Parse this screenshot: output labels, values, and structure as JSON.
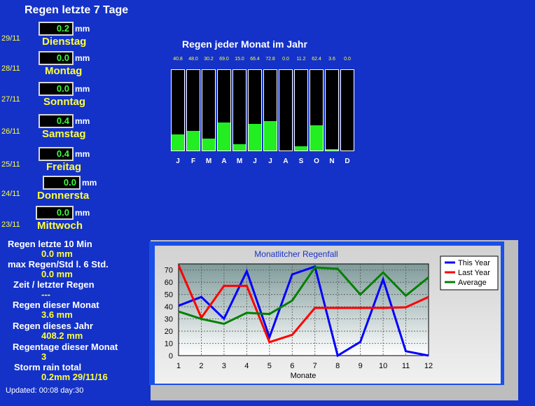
{
  "week": {
    "title": "Regen letzte 7 Tage",
    "unit": "mm",
    "days": [
      {
        "date": "29/11",
        "value": "0.2",
        "name": "Dienstag"
      },
      {
        "date": "28/11",
        "value": "0.0",
        "name": "Montag"
      },
      {
        "date": "27/11",
        "value": "0.0",
        "name": "Sonntag"
      },
      {
        "date": "26/11",
        "value": "0.4",
        "name": "Samstag"
      },
      {
        "date": "25/11",
        "value": "0.4",
        "name": "Freitag"
      },
      {
        "date": "24/11",
        "value": "0.0",
        "name": "Donnersta"
      },
      {
        "date": "23/11",
        "value": "0.0",
        "name": "Mittwoch"
      }
    ]
  },
  "stats": [
    {
      "label": "Regen letzte 10 Min",
      "value": "0.0 mm"
    },
    {
      "label": "max Regen/Std l. 6 Std.",
      "value": "0.0 mm"
    },
    {
      "label": "Zeit / letzter Regen",
      "value": "---"
    },
    {
      "label": "Regen dieser Monat",
      "value": "3.6 mm"
    },
    {
      "label": "Regen dieses Jahr",
      "value": "408.2 mm"
    },
    {
      "label": "Regentage dieser Monat",
      "value": "3"
    },
    {
      "label": "Storm rain total",
      "value": "0.2mm 29/11/16"
    }
  ],
  "updated": "Updated: 00:08 day:30",
  "colors": {
    "background": "#1432c8",
    "label_yellow": "#ffff40",
    "bar_green": "#22ee22",
    "this_year": "#0000ff",
    "last_year": "#ff0000",
    "average": "#008000"
  },
  "chart_data": [
    {
      "type": "bar",
      "title": "Regen jeder Monat im Jahr",
      "categories": [
        "J",
        "F",
        "M",
        "A",
        "M",
        "J",
        "J",
        "A",
        "S",
        "O",
        "N",
        "D"
      ],
      "value_labels": [
        "40.8",
        "48.0",
        "30.2",
        "69.0",
        "15.0",
        "66.4",
        "72.8",
        "0.0",
        "11.2",
        "62.4",
        "3.6",
        "0.0"
      ],
      "values": [
        40.8,
        48.0,
        30.2,
        69.0,
        15.0,
        66.4,
        72.8,
        0.0,
        11.2,
        62.4,
        3.6,
        0.0
      ],
      "ylim": [
        0,
        200
      ]
    },
    {
      "type": "line",
      "title": "Monatlitcher Regenfall",
      "xlabel": "Monate",
      "x": [
        1,
        2,
        3,
        4,
        5,
        6,
        7,
        8,
        9,
        10,
        11,
        12
      ],
      "xticks": [
        "1",
        "2",
        "3",
        "4",
        "5",
        "6",
        "7",
        "8",
        "9",
        "10",
        "11",
        "12"
      ],
      "yticks": [
        "0",
        "10",
        "20",
        "30",
        "40",
        "50",
        "60",
        "70"
      ],
      "ylim": [
        0,
        75
      ],
      "grid": true,
      "legend_position": "top-right",
      "series": [
        {
          "name": "This Year",
          "color": "#0000ff",
          "values": [
            40.8,
            48.0,
            30.2,
            69.0,
            15.0,
            66.4,
            72.8,
            0.0,
            11.2,
            62.4,
            3.6,
            0.0
          ]
        },
        {
          "name": "Last Year",
          "color": "#ff0000",
          "values": [
            74,
            31,
            57,
            57,
            11,
            17,
            39,
            39,
            39,
            39,
            39.5,
            48
          ]
        },
        {
          "name": "Average",
          "color": "#008000",
          "values": [
            36,
            30,
            26,
            35,
            34,
            45,
            72,
            71,
            50,
            68,
            49,
            64
          ]
        }
      ]
    }
  ]
}
